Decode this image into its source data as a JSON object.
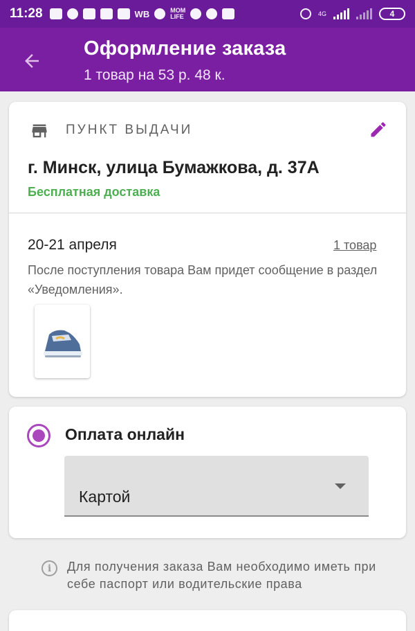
{
  "status_bar": {
    "time": "11:28",
    "app_icons": [
      "message-icon",
      "sneaker-icon",
      "video-icon",
      "video-icon",
      "shopping-bag-icon",
      "wb-icon",
      "pin-icon",
      "momlife-icon",
      "ok-icon",
      "sneaker-icon",
      "trash-icon"
    ],
    "wb_label": "WB",
    "momlife_label": "MOM LIFE",
    "network_label": "4G",
    "battery_level": "4"
  },
  "app_bar": {
    "title": "Оформление заказа",
    "subtitle": "1 товар на 53 р. 48 к."
  },
  "pickup": {
    "label": "ПУНКТ ВЫДАЧИ",
    "address": "г. Минск, улица Бумажкова, д. 37А",
    "delivery_note": "Бесплатная доставка",
    "date": "20-21 апреля",
    "items_link": "1 товар",
    "notification_note": "После поступления товара Вам придет сообщение в раздел «Уведомления»."
  },
  "payment": {
    "option_label": "Оплата онлайн",
    "selected": true,
    "method_value": "Картой"
  },
  "info_note": "Для получения заказа Вам необходимо иметь при себе паспорт или водительские права",
  "colors": {
    "status_bar": "#6a1b9a",
    "app_bar": "#7b1fa2",
    "accent": "#ab47bc",
    "free_delivery": "#4caf50",
    "background": "#eeeeee"
  }
}
